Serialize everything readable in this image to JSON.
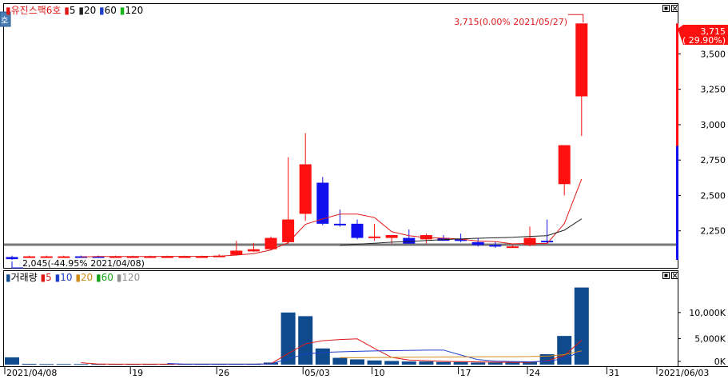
{
  "header": {
    "stock_name": "유진스팩6호",
    "ma_labels": [
      "5",
      "20",
      "60",
      "120"
    ],
    "ma_colors": [
      "#e01818",
      "#202020",
      "#1c3fcc",
      "#18b418"
    ],
    "side_tab": "호"
  },
  "volume_header": {
    "label": "거래량",
    "ma_labels": [
      "5",
      "10",
      "20",
      "60",
      "120"
    ],
    "ma_colors": [
      "#e01818",
      "#1c3fcc",
      "#d08a18",
      "#18a418",
      "#909090"
    ]
  },
  "annotations": {
    "high": "3,715(0.00% 2021/05/27)",
    "low": "2,045(-44.95% 2021/04/08)"
  },
  "price_tag": {
    "value": "3,715",
    "change": "( 29.90%)"
  },
  "y_ticks": [
    "3,500",
    "3,250",
    "3,000",
    "2,750",
    "2,500",
    "2,250"
  ],
  "vol_ticks": [
    "10,000K",
    "5,000K",
    "0K"
  ],
  "x_ticks": [
    "2021/04/08",
    "19",
    "26",
    "05/03",
    "10",
    "17",
    "24",
    "31",
    "2021/06/03"
  ],
  "colors": {
    "up": "#ff1010",
    "down": "#1010ee",
    "volume": "#0f4a8c"
  },
  "chart_data": {
    "type": "candlestick",
    "title": "유진스팩6호",
    "x": [
      "2021/04/08",
      "2021/04/09",
      "2021/04/12",
      "2021/04/13",
      "2021/04/14",
      "2021/04/15",
      "2021/04/16",
      "2021/04/19",
      "2021/04/20",
      "2021/04/21",
      "2021/04/22",
      "2021/04/23",
      "2021/04/26",
      "2021/04/27",
      "2021/04/28",
      "2021/04/29",
      "2021/04/30",
      "2021/05/03",
      "2021/05/04",
      "2021/05/06",
      "2021/05/07",
      "2021/05/10",
      "2021/05/11",
      "2021/05/12",
      "2021/05/13",
      "2021/05/14",
      "2021/05/17",
      "2021/05/18",
      "2021/05/20",
      "2021/05/21",
      "2021/05/24",
      "2021/05/25",
      "2021/05/26",
      "2021/05/27"
    ],
    "open": [
      2065,
      2070,
      2070,
      2068,
      2070,
      2070,
      2068,
      2070,
      2070,
      2070,
      2070,
      2070,
      2075,
      2080,
      2105,
      2120,
      2170,
      2370,
      2590,
      2300,
      2300,
      2200,
      2200,
      2200,
      2190,
      2200,
      2190,
      2170,
      2150,
      2140,
      2150,
      2180,
      2580,
      3200
    ],
    "high": [
      2075,
      2075,
      2075,
      2075,
      2075,
      2075,
      2075,
      2075,
      2075,
      2075,
      2075,
      2075,
      2085,
      2180,
      2165,
      2210,
      2770,
      2940,
      2630,
      2400,
      2330,
      2300,
      2220,
      2260,
      2230,
      2220,
      2230,
      2200,
      2175,
      2150,
      2280,
      2330,
      2855,
      3715
    ],
    "low": [
      2045,
      2060,
      2060,
      2060,
      2062,
      2062,
      2060,
      2062,
      2062,
      2062,
      2062,
      2062,
      2070,
      2075,
      2100,
      2115,
      2160,
      2320,
      2290,
      2280,
      2190,
      2180,
      2160,
      2160,
      2160,
      2180,
      2170,
      2140,
      2130,
      2130,
      2140,
      2160,
      2500,
      2920
    ],
    "close": [
      2050,
      2070,
      2070,
      2070,
      2068,
      2068,
      2070,
      2070,
      2070,
      2070,
      2070,
      2070,
      2075,
      2110,
      2120,
      2200,
      2330,
      2720,
      2300,
      2290,
      2200,
      2210,
      2220,
      2160,
      2220,
      2180,
      2180,
      2150,
      2140,
      2140,
      2200,
      2170,
      2855,
      3715
    ],
    "volume_k": [
      1400,
      150,
      100,
      100,
      100,
      100,
      100,
      100,
      100,
      100,
      100,
      100,
      100,
      100,
      100,
      400,
      10000,
      9300,
      3100,
      1300,
      1000,
      800,
      700,
      600,
      600,
      500,
      500,
      400,
      400,
      400,
      500,
      2000,
      5500,
      14800
    ],
    "ma5_end": 2620,
    "ylim": [
      2045,
      3745
    ],
    "volume_ylim": [
      0,
      15500
    ],
    "log_scale": false,
    "grid": false
  }
}
